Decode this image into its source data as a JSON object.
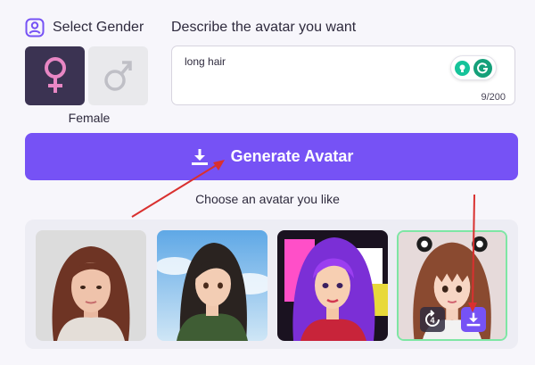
{
  "gender_section": {
    "title": "Select Gender",
    "icon": "user-icon",
    "options": [
      {
        "name": "female",
        "symbol": "♀",
        "selected": true
      },
      {
        "name": "male",
        "symbol": "♂",
        "selected": false
      }
    ],
    "selected_label": "Female"
  },
  "description": {
    "title": "Describe the avatar you want",
    "value": "long hair",
    "counter": "9/200",
    "extension_icons": [
      "grammarly-bulb-icon",
      "grammarly-g-icon"
    ]
  },
  "generate_button": {
    "label": "Generate Avatar",
    "icon": "download-icon"
  },
  "choose_label": "Choose an avatar you like",
  "avatars": [
    {
      "name": "avatar-1",
      "style": "realistic",
      "selected": false
    },
    {
      "name": "avatar-2",
      "style": "anime-sky",
      "selected": false
    },
    {
      "name": "avatar-3",
      "style": "pop-art-purple",
      "selected": false
    },
    {
      "name": "avatar-4",
      "style": "doll-bangs",
      "selected": true,
      "actions": [
        {
          "name": "regenerate",
          "icon": "regenerate-icon",
          "count": "4"
        },
        {
          "name": "download",
          "icon": "download-icon"
        }
      ]
    }
  ],
  "colors": {
    "accent": "#7652f5",
    "selected_gender_bg": "#3b3352",
    "female_symbol": "#e887c4",
    "selected_card_border": "#7ee6a4",
    "annotation_arrow": "#d9302f"
  }
}
